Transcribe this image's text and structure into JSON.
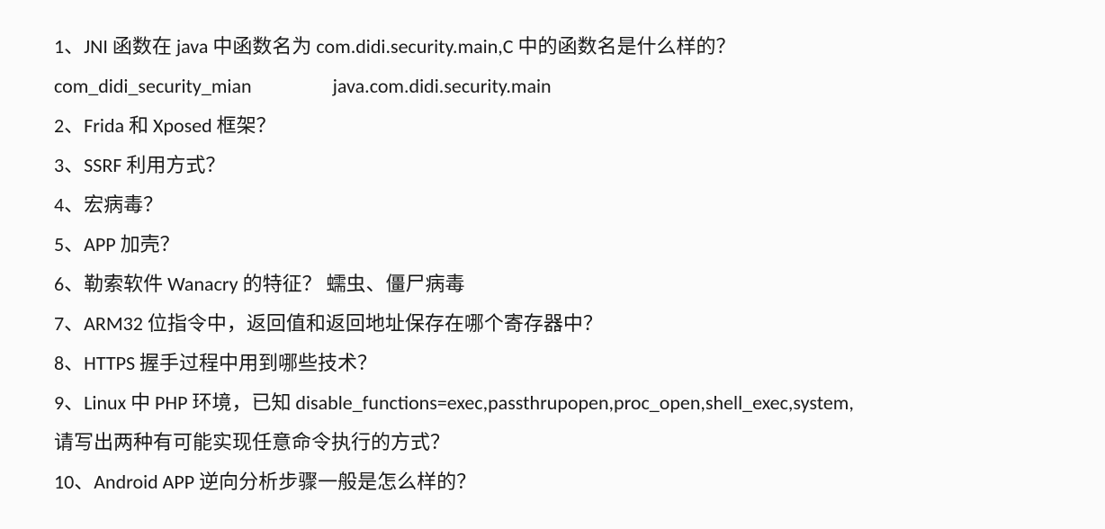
{
  "lines": {
    "q1": "1、JNI 函数在 java 中函数名为 com.didi.security.main,C 中的函数名是什么样的？",
    "q1_answer_a": "com_didi_security_mian",
    "q1_answer_b": "java.com.didi.security.main",
    "q2": "2、Frida 和 Xposed 框架？",
    "q3": "3、SSRF 利用方式？",
    "q4": "4、宏病毒？",
    "q5": "5、APP 加壳？",
    "q6": "6、勒索软件 Wanacry 的特征？    蠕虫、僵尸病毒",
    "q7": "7、ARM32 位指令中，返回值和返回地址保存在哪个寄存器中？",
    "q8": "8、HTTPS 握手过程中用到哪些技术？",
    "q9a": "9、Linux 中 PHP 环境，已知 disable_functions=exec,passthrupopen,proc_open,shell_exec,system,",
    "q9b": "请写出两种有可能实现任意命令执行的方式？",
    "q10": "10、Android APP 逆向分析步骤一般是怎么样的？"
  }
}
